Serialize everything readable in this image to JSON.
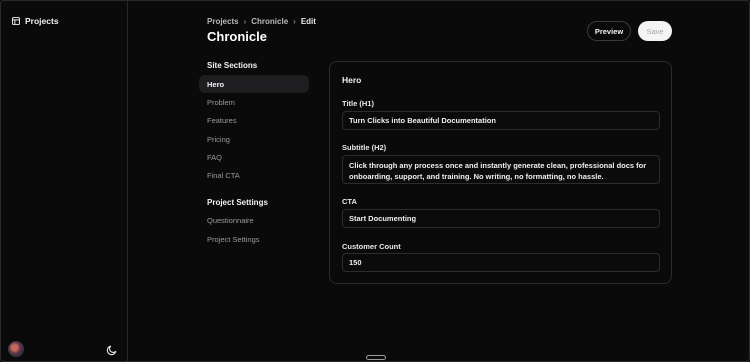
{
  "rail": {
    "projects_label": "Projects",
    "projects_icon": "layout-icon",
    "theme_icon": "moon-icon"
  },
  "breadcrumb": [
    "Projects",
    "Chronicle",
    "Edit"
  ],
  "page_title": "Chronicle",
  "actions": {
    "preview": "Preview",
    "save": "Save"
  },
  "site_sections": {
    "heading": "Site Sections",
    "items": [
      "Hero",
      "Problem",
      "Features",
      "Pricing",
      "FAQ",
      "Final CTA"
    ],
    "active": "Hero"
  },
  "project_settings": {
    "heading": "Project Settings",
    "items": [
      "Questionnaire",
      "Project Settings"
    ]
  },
  "form": {
    "title": "Hero",
    "fields": [
      {
        "label": "Title (H1)",
        "value": "Turn Clicks into Beautiful Documentation"
      },
      {
        "label": "Subtitle (H2)",
        "value": "Click through any process once and instantly generate clean, professional docs for onboarding, support, and training. No writing, no formatting, no hassle."
      },
      {
        "label": "CTA",
        "value": "Start Documenting"
      },
      {
        "label": "Customer Count",
        "value": "150"
      }
    ]
  },
  "colors": {
    "background": "#0a0a0b",
    "border": "#2c2c30",
    "active_nav": "#1e1e21"
  }
}
